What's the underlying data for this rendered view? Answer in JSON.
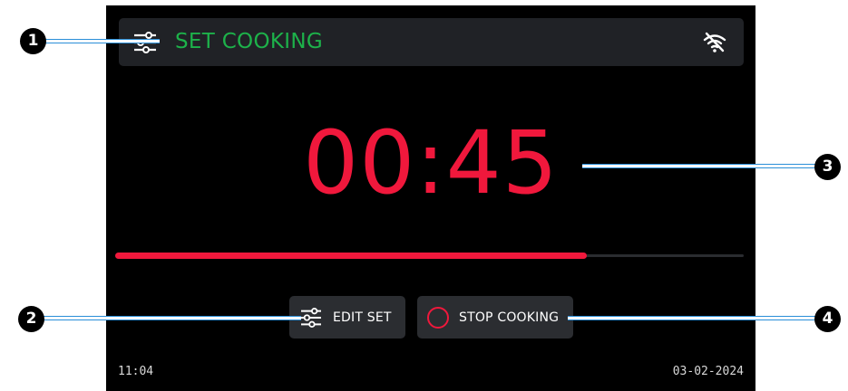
{
  "header": {
    "title": "SET COOKING",
    "icon": "sliders-icon",
    "status_icon": "wifi-off-icon"
  },
  "timer": {
    "value": "00:45"
  },
  "progress": {
    "fraction": 0.75
  },
  "buttons": {
    "edit_set_label": "EDIT SET",
    "stop_cooking_label": "STOP COOKING"
  },
  "footer": {
    "time": "11:04",
    "date": "03-02-2024"
  },
  "callouts": [
    "1",
    "2",
    "3",
    "4"
  ],
  "colors": {
    "title_green": "#1db24a",
    "timer_red": "#f0183c",
    "callout_blue": "#2a8fd8"
  }
}
